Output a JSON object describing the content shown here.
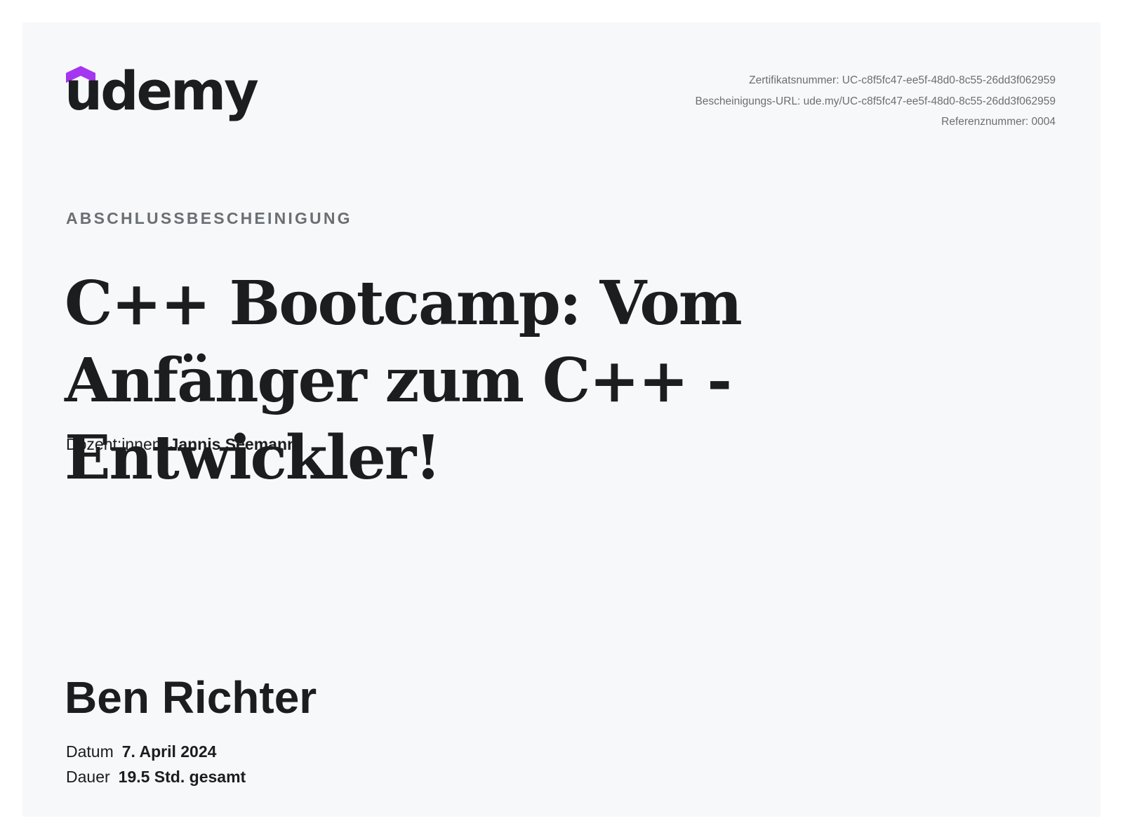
{
  "brand": {
    "logo_text": "udemy",
    "roof_color": "#a435f0"
  },
  "meta": {
    "certificate_number": "Zertifikatsnummer: UC-c8f5fc47-ee5f-48d0-8c55-26dd3f062959",
    "certificate_url": "Bescheinigungs-URL: ude.my/UC-c8f5fc47-ee5f-48d0-8c55-26dd3f062959",
    "reference_number": "Referenznummer: 0004"
  },
  "certificate": {
    "label": "ABSCHLUSSBESCHEINIGUNG",
    "course_title": "C++ Bootcamp: Vom Anfänger zum C++ - Entwickler!",
    "instructors_label": "Dozent:innen",
    "instructors_name": "Jannis Seemann",
    "student_name": "Ben Richter",
    "date_label": "Datum",
    "date_value": "7. April 2024",
    "duration_label": "Dauer",
    "duration_value": "19.5 Std. gesamt"
  }
}
